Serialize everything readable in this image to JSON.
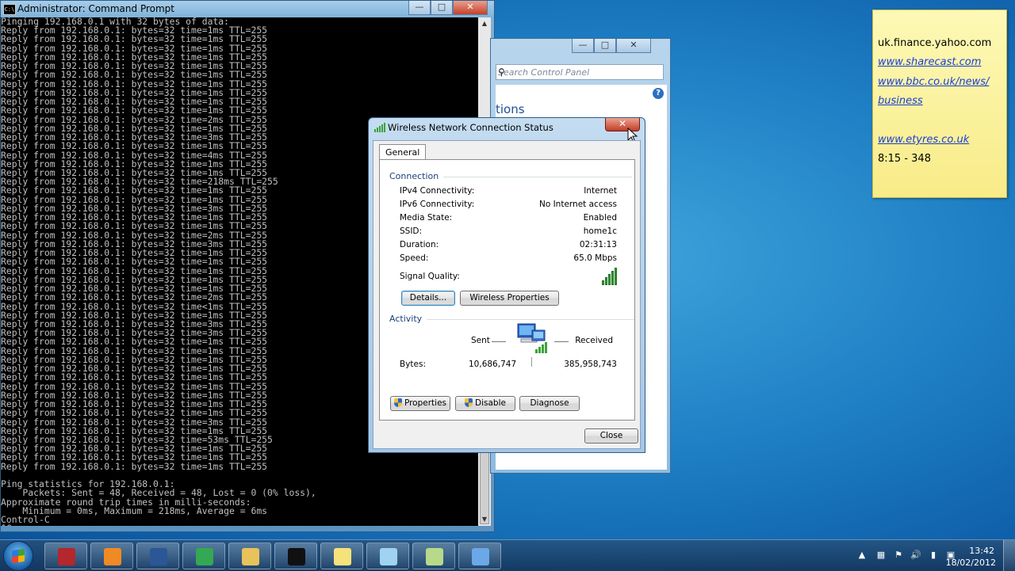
{
  "cmd": {
    "title": "Administrator: Command Prompt",
    "icon_text": "C:\\",
    "lines": [
      "Pinging 192.168.0.1 with 32 bytes of data:",
      "Reply from 192.168.0.1: bytes=32 time=1ms TTL=255",
      "Reply from 192.168.0.1: bytes=32 time=1ms TTL=255",
      "Reply from 192.168.0.1: bytes=32 time=1ms TTL=255",
      "Reply from 192.168.0.1: bytes=32 time=1ms TTL=255",
      "Reply from 192.168.0.1: bytes=32 time=1ms TTL=255",
      "Reply from 192.168.0.1: bytes=32 time=1ms TTL=255",
      "Reply from 192.168.0.1: bytes=32 time=1ms TTL=255",
      "Reply from 192.168.0.1: bytes=32 time=1ms TTL=255",
      "Reply from 192.168.0.1: bytes=32 time=1ms TTL=255",
      "Reply from 192.168.0.1: bytes=32 time=1ms TTL=255",
      "Reply from 192.168.0.1: bytes=32 time=2ms TTL=255",
      "Reply from 192.168.0.1: bytes=32 time=1ms TTL=255",
      "Reply from 192.168.0.1: bytes=32 time=3ms TTL=255",
      "Reply from 192.168.0.1: bytes=32 time=1ms TTL=255",
      "Reply from 192.168.0.1: bytes=32 time=4ms TTL=255",
      "Reply from 192.168.0.1: bytes=32 time=1ms TTL=255",
      "Reply from 192.168.0.1: bytes=32 time=1ms TTL=255",
      "Reply from 192.168.0.1: bytes=32 time=218ms TTL=255",
      "Reply from 192.168.0.1: bytes=32 time=1ms TTL=255",
      "Reply from 192.168.0.1: bytes=32 time=1ms TTL=255",
      "Reply from 192.168.0.1: bytes=32 time=3ms TTL=255",
      "Reply from 192.168.0.1: bytes=32 time=1ms TTL=255",
      "Reply from 192.168.0.1: bytes=32 time=1ms TTL=255",
      "Reply from 192.168.0.1: bytes=32 time=2ms TTL=255",
      "Reply from 192.168.0.1: bytes=32 time=3ms TTL=255",
      "Reply from 192.168.0.1: bytes=32 time=1ms TTL=255",
      "Reply from 192.168.0.1: bytes=32 time=1ms TTL=255",
      "Reply from 192.168.0.1: bytes=32 time=1ms TTL=255",
      "Reply from 192.168.0.1: bytes=32 time=1ms TTL=255",
      "Reply from 192.168.0.1: bytes=32 time=1ms TTL=255",
      "Reply from 192.168.0.1: bytes=32 time=2ms TTL=255",
      "Reply from 192.168.0.1: bytes=32 time<1ms TTL=255",
      "Reply from 192.168.0.1: bytes=32 time=1ms TTL=255",
      "Reply from 192.168.0.1: bytes=32 time=3ms TTL=255",
      "Reply from 192.168.0.1: bytes=32 time=3ms TTL=255",
      "Reply from 192.168.0.1: bytes=32 time=1ms TTL=255",
      "Reply from 192.168.0.1: bytes=32 time=1ms TTL=255",
      "Reply from 192.168.0.1: bytes=32 time=1ms TTL=255",
      "Reply from 192.168.0.1: bytes=32 time=1ms TTL=255",
      "Reply from 192.168.0.1: bytes=32 time=1ms TTL=255",
      "Reply from 192.168.0.1: bytes=32 time=1ms TTL=255",
      "Reply from 192.168.0.1: bytes=32 time=1ms TTL=255",
      "Reply from 192.168.0.1: bytes=32 time=1ms TTL=255",
      "Reply from 192.168.0.1: bytes=32 time=1ms TTL=255",
      "Reply from 192.168.0.1: bytes=32 time=3ms TTL=255",
      "Reply from 192.168.0.1: bytes=32 time=1ms TTL=255",
      "Reply from 192.168.0.1: bytes=32 time=53ms TTL=255",
      "Reply from 192.168.0.1: bytes=32 time=1ms TTL=255",
      "Reply from 192.168.0.1: bytes=32 time=1ms TTL=255",
      "Reply from 192.168.0.1: bytes=32 time=1ms TTL=255",
      "",
      "Ping statistics for 192.168.0.1:",
      "    Packets: Sent = 48, Received = 48, Lost = 0 (0% loss),",
      "Approximate round trip times in milli-seconds:",
      "    Minimum = 0ms, Maximum = 218ms, Average = 6ms",
      "Control-C",
      "^C",
      "C:\\Users\\admin>"
    ]
  },
  "control_panel": {
    "search_placeholder": "Search Control Panel",
    "heading_fragment": "tions",
    "help_label": "?"
  },
  "dialog": {
    "title": "Wireless Network Connection Status",
    "tab": "General",
    "connection_header": "Connection",
    "rows": [
      {
        "label": "IPv4 Connectivity:",
        "value": "Internet"
      },
      {
        "label": "IPv6 Connectivity:",
        "value": "No Internet access"
      },
      {
        "label": "Media State:",
        "value": "Enabled"
      },
      {
        "label": "SSID:",
        "value": "home1c"
      },
      {
        "label": "Duration:",
        "value": "02:31:13"
      },
      {
        "label": "Speed:",
        "value": "65.0 Mbps"
      }
    ],
    "signal_label": "Signal Quality:",
    "signal_bars": 5,
    "details_btn": "Details...",
    "wireless_props_btn": "Wireless Properties",
    "activity_header": "Activity",
    "sent_label": "Sent",
    "received_label": "Received",
    "bytes_label": "Bytes:",
    "bytes_sent": "10,686,747",
    "bytes_received": "385,958,743",
    "properties_btn": "Properties",
    "disable_btn": "Disable",
    "diagnose_btn": "Diagnose",
    "close_btn": "Close"
  },
  "sticky_note": {
    "lines": [
      {
        "text": "uk.finance.yahoo.com",
        "link": false
      },
      {
        "text": "www.sharecast.com",
        "link": true
      },
      {
        "text": "www.bbc.co.uk/news/",
        "link": true
      },
      {
        "text": "business",
        "link": true
      },
      {
        "text": "www.etyres.co.uk",
        "link": true
      },
      {
        "text": "8:15 - 348",
        "link": false
      }
    ]
  },
  "taskbar": {
    "apps": [
      {
        "name": "app-icon",
        "color": "#b3272d"
      },
      {
        "name": "media-player-icon",
        "color": "#f08a24"
      },
      {
        "name": "word-icon",
        "color": "#2b5797"
      },
      {
        "name": "chrome-icon",
        "color": "#34a853"
      },
      {
        "name": "explorer-icon",
        "color": "#e8c25a"
      },
      {
        "name": "cmd-icon",
        "color": "#111111"
      },
      {
        "name": "sticky-notes-icon",
        "color": "#f5e27a"
      },
      {
        "name": "notepad-icon",
        "color": "#9fd3f0"
      },
      {
        "name": "folder-icon",
        "color": "#b7d98a"
      },
      {
        "name": "control-panel-icon",
        "color": "#6aa8e8"
      }
    ],
    "clock_time": "13:42",
    "clock_date": "18/02/2012"
  }
}
